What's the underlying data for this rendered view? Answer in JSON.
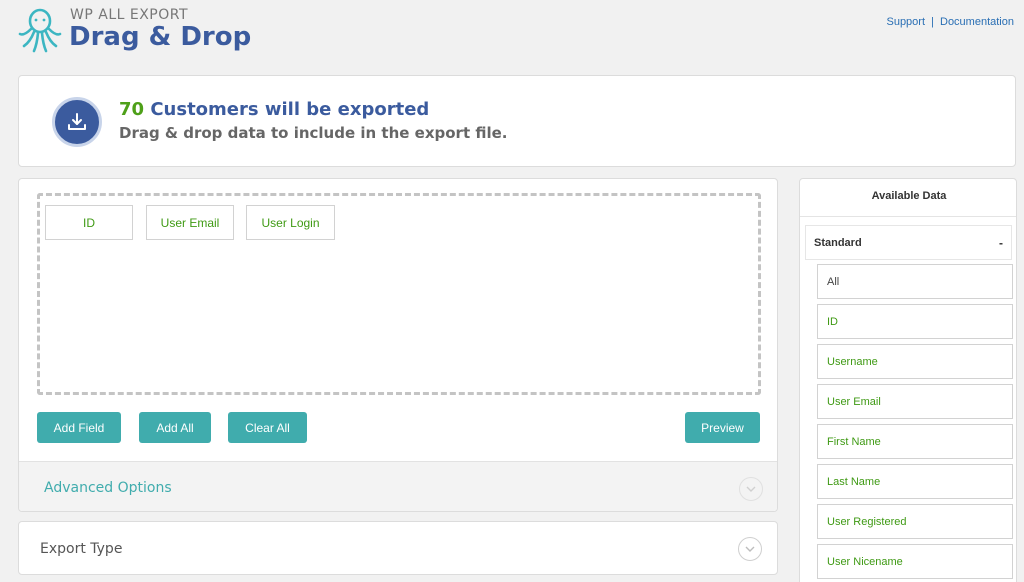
{
  "header": {
    "brand_top": "WP ALL EXPORT",
    "brand_main": "Drag & Drop",
    "support_link": "Support",
    "separator": "|",
    "documentation_link": "Documentation"
  },
  "summary": {
    "count": "70",
    "headline_rest": "Customers will be exported",
    "subtitle": "Drag & drop data to include in the export file."
  },
  "dropzone": {
    "fields": [
      "ID",
      "User Email",
      "User Login"
    ]
  },
  "actions": {
    "add_field": "Add Field",
    "add_all": "Add All",
    "clear_all": "Clear All",
    "preview": "Preview"
  },
  "advanced": {
    "label": "Advanced Options"
  },
  "export_type": {
    "label": "Export Type"
  },
  "available": {
    "title": "Available Data",
    "section": {
      "label": "Standard",
      "toggle": "-"
    },
    "items": [
      "All",
      "ID",
      "Username",
      "User Email",
      "First Name",
      "Last Name",
      "User Registered",
      "User Nicename"
    ]
  },
  "colors": {
    "brand_blue": "#3b5b9e",
    "accent_teal": "#40acad",
    "field_green": "#3f9a14",
    "count_green": "#4ea019",
    "link_blue": "#2a6fb4"
  },
  "icons": {
    "logo": "octopus-logo-icon",
    "summary": "download-tray-icon",
    "advanced_chevron": "chevron-down-icon",
    "export_type_chevron": "chevron-down-icon"
  }
}
